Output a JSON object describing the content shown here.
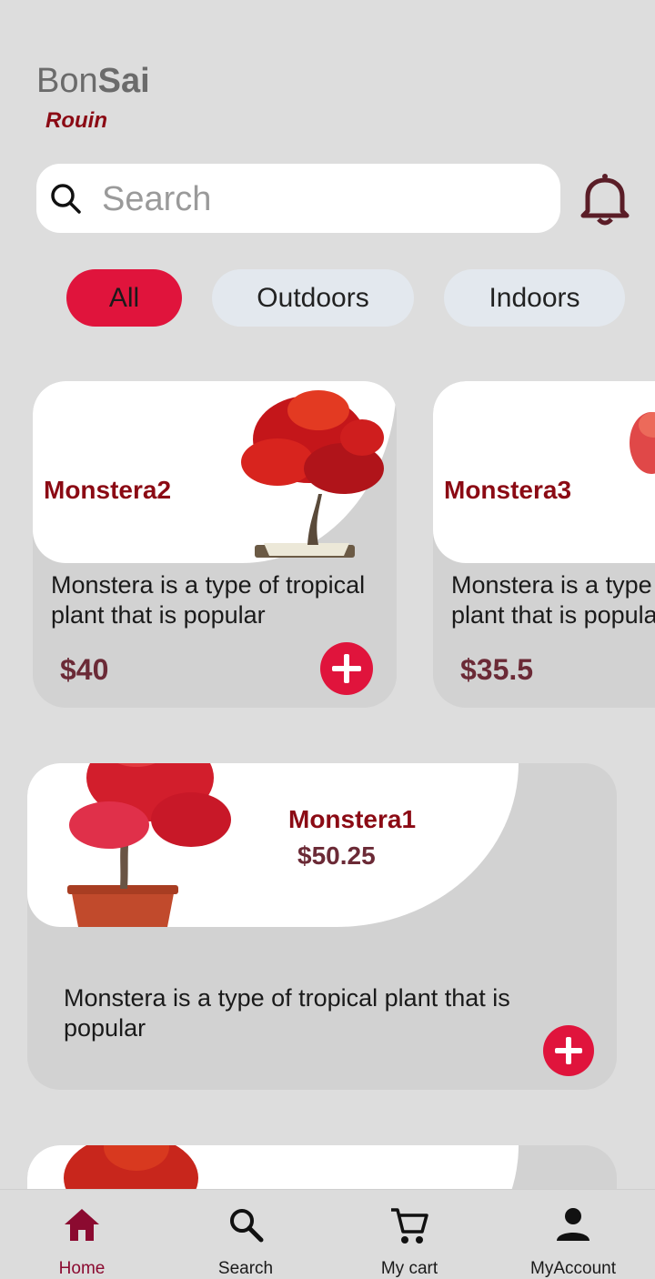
{
  "header": {
    "title_light": "Bon",
    "title_bold": "Sai",
    "subtitle": "Rouin"
  },
  "search": {
    "placeholder": "Search"
  },
  "filters": [
    {
      "label": "All",
      "active": true
    },
    {
      "label": "Outdoors",
      "active": false
    },
    {
      "label": "Indoors",
      "active": false
    }
  ],
  "horizontal_cards": [
    {
      "name": "Monstera2",
      "description": "Monstera is a type of tropical plant that is popular",
      "price": "$40"
    },
    {
      "name": "Monstera3",
      "description": "Monstera is a type of tropical plant that is popular",
      "price": "$35.5"
    }
  ],
  "featured_card": {
    "name": "Monstera1",
    "price": "$50.25",
    "description": "Monstera is a type of tropical plant that is popular"
  },
  "bottom_nav": [
    {
      "label": "Home",
      "icon": "home-icon",
      "active": true
    },
    {
      "label": "Search",
      "icon": "search-icon",
      "active": false
    },
    {
      "label": "My cart",
      "icon": "cart-icon",
      "active": false
    },
    {
      "label": "MyAccount",
      "icon": "account-icon",
      "active": false
    }
  ],
  "colors": {
    "accent": "#e0143c",
    "brand_dark": "#8b0a14",
    "price": "#6b2a36",
    "background": "#dddddd"
  }
}
